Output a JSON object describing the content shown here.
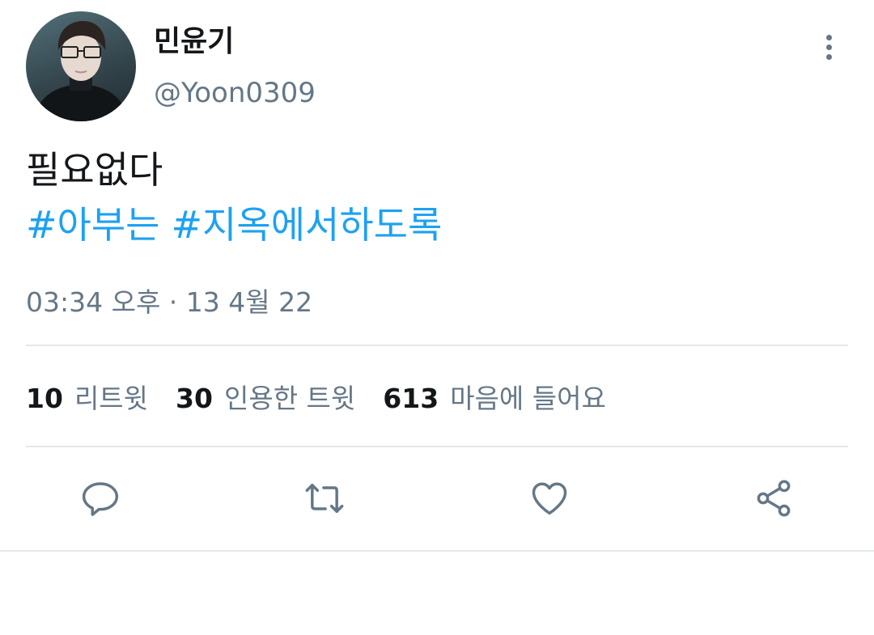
{
  "user": {
    "display_name": "민윤기",
    "handle": "@Yoon0309",
    "avatar_icon": "profile-avatar"
  },
  "tweet": {
    "text": "필요없다",
    "hashtags": [
      "#아부는",
      "#지옥에서하도록"
    ],
    "timestamp": "03:34 오후 · 13 4월 22"
  },
  "stats": [
    {
      "count": "10",
      "label": "리트윗"
    },
    {
      "count": "30",
      "label": "인용한 트윗"
    },
    {
      "count": "613",
      "label": "마음에 들어요"
    }
  ],
  "actions": {
    "reply_icon": "reply-icon",
    "retweet_icon": "retweet-icon",
    "like_icon": "heart-icon",
    "share_icon": "share-icon",
    "more_icon": "more-vertical-icon"
  },
  "colors": {
    "text_primary": "#14171a",
    "text_secondary": "#657786",
    "hashtag": "#1da1f2",
    "divider": "#e1e8ed"
  }
}
